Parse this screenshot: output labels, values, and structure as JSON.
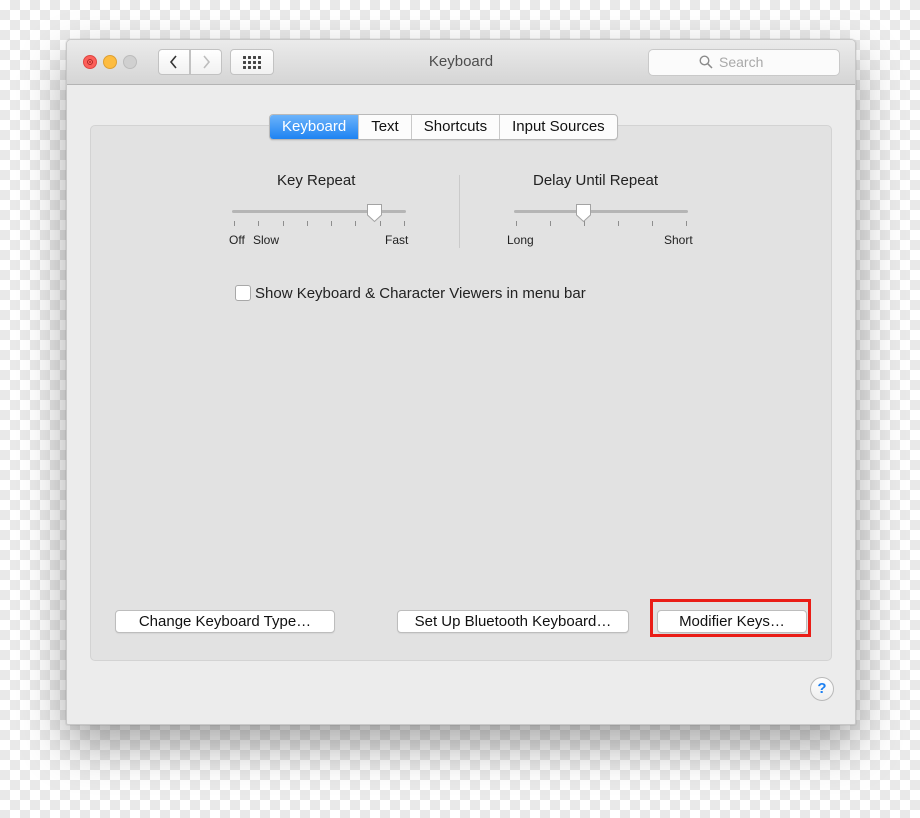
{
  "window": {
    "title": "Keyboard"
  },
  "toolbar": {
    "search_placeholder": "Search",
    "icons": {
      "back": "chevron-left-icon",
      "forward": "chevron-right-icon",
      "show_all": "grid-icon",
      "search": "search-icon"
    }
  },
  "tabs": [
    {
      "label": "Keyboard",
      "active": true
    },
    {
      "label": "Text",
      "active": false
    },
    {
      "label": "Shortcuts",
      "active": false
    },
    {
      "label": "Input Sources",
      "active": false
    }
  ],
  "key_repeat": {
    "title": "Key Repeat",
    "min_label": "Off",
    "slow_label": "Slow",
    "max_label": "Fast",
    "value_fraction": 0.82
  },
  "delay_until_repeat": {
    "title": "Delay Until Repeat",
    "min_label": "Long",
    "max_label": "Short",
    "value_fraction": 0.4
  },
  "options": {
    "show_viewers_label": "Show Keyboard & Character Viewers in menu bar",
    "show_viewers_checked": false
  },
  "buttons": {
    "change_type": "Change Keyboard Type…",
    "bluetooth": "Set Up Bluetooth Keyboard…",
    "modifier": "Modifier Keys…",
    "help": "?"
  },
  "colors": {
    "accent": "#1e83f2",
    "highlight_border": "#ea1d17",
    "close": "#fc605b",
    "minimize": "#fdbc40"
  }
}
